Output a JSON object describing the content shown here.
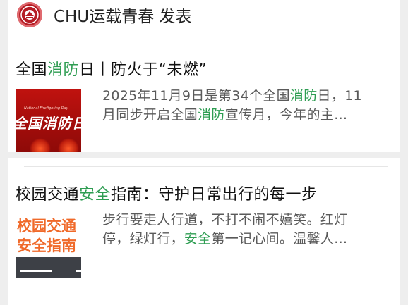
{
  "account": {
    "name": "CHU运载青春 发表",
    "avatar_icon": "university-emblem-icon",
    "avatar_color": "#b51c24"
  },
  "highlight_color": "#2e9d52",
  "articles": [
    {
      "title_parts": [
        "全国",
        "消防",
        "日丨防火于“未燃”"
      ],
      "thumbnail": {
        "big_text": "全国消防日",
        "small_text": "National Firefighting Day"
      },
      "summary_lines": [
        [
          "2025年11月9日是第34个全国",
          "消防",
          "日，11"
        ],
        [
          "月同步开启全国",
          "消防",
          "宣传月，今年的主…"
        ]
      ]
    },
    {
      "title_parts": [
        "校园交通",
        "安全",
        "指南：守护日常出行的每一步"
      ],
      "thumbnail": {
        "line1": "校园交通",
        "line2": "安全指南"
      },
      "summary_lines": [
        [
          "步行要走人行道，不打不闹不嬉笑。红灯",
          "",
          ""
        ],
        [
          "停，绿灯行，",
          "安全",
          "第一记心间。温馨人…"
        ]
      ]
    }
  ]
}
